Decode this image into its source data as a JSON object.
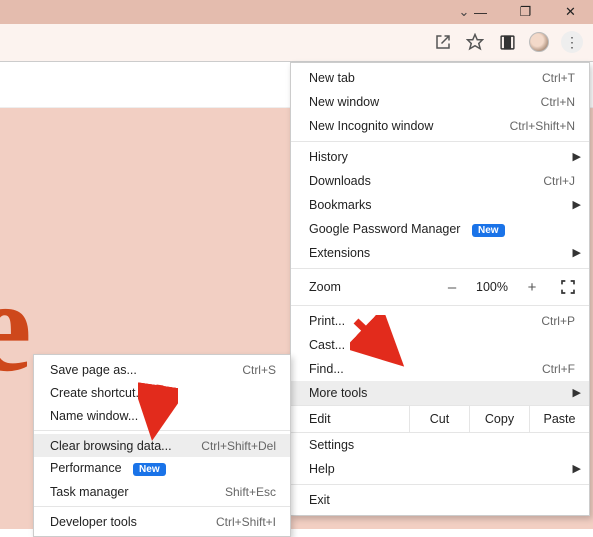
{
  "window": {
    "minimize_sym": "—",
    "maximize_sym": "❐",
    "close_sym": "✕",
    "chevron_down_sym": "⌄"
  },
  "toolbar": {
    "share_sym": "↗",
    "star_sym": "☆",
    "extensions_sym": "▣",
    "kebab_sym": "⋮"
  },
  "page": {
    "big_letter": "e"
  },
  "menu": {
    "new_tab": {
      "label": "New tab",
      "shortcut": "Ctrl+T"
    },
    "new_window": {
      "label": "New window",
      "shortcut": "Ctrl+N"
    },
    "incognito": {
      "label": "New Incognito window",
      "shortcut": "Ctrl+Shift+N"
    },
    "history": {
      "label": "History"
    },
    "downloads": {
      "label": "Downloads",
      "shortcut": "Ctrl+J"
    },
    "bookmarks": {
      "label": "Bookmarks"
    },
    "pwd_manager": {
      "label": "Google Password Manager",
      "badge": "New"
    },
    "extensions": {
      "label": "Extensions"
    },
    "zoom": {
      "label": "Zoom",
      "minus": "–",
      "pct": "100%",
      "plus": "+"
    },
    "print": {
      "label": "Print...",
      "shortcut": "Ctrl+P"
    },
    "cast": {
      "label": "Cast..."
    },
    "find": {
      "label": "Find...",
      "shortcut": "Ctrl+F"
    },
    "more_tools": {
      "label": "More tools"
    },
    "edit": {
      "label": "Edit",
      "cut": "Cut",
      "copy": "Copy",
      "paste": "Paste"
    },
    "settings": {
      "label": "Settings"
    },
    "help": {
      "label": "Help"
    },
    "exit": {
      "label": "Exit"
    }
  },
  "submenu": {
    "save_page": {
      "label": "Save page as...",
      "shortcut": "Ctrl+S"
    },
    "create_shortcut": {
      "label": "Create shortcut..."
    },
    "name_window": {
      "label": "Name window..."
    },
    "clear_data": {
      "label": "Clear browsing data...",
      "shortcut": "Ctrl+Shift+Del"
    },
    "performance": {
      "label": "Performance",
      "badge": "New"
    },
    "task_manager": {
      "label": "Task manager",
      "shortcut": "Shift+Esc"
    },
    "devtools": {
      "label": "Developer tools",
      "shortcut": "Ctrl+Shift+I"
    }
  }
}
